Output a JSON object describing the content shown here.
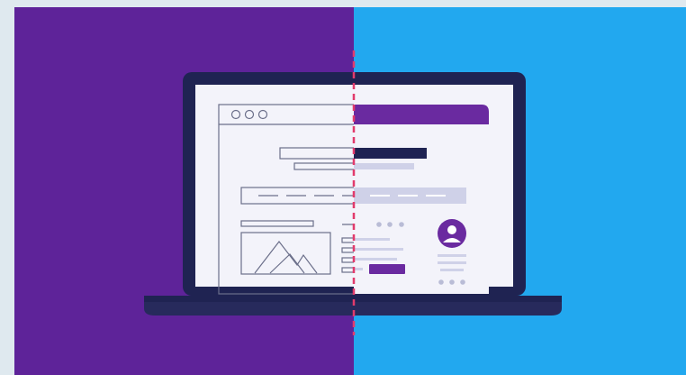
{
  "illustration": {
    "concept": "wireframe-to-design-split",
    "colors": {
      "outer_border": "#dfe9ef",
      "left_background": "#5e2399",
      "right_background": "#22a8ef",
      "laptop_frame": "#1f2352",
      "laptop_base": "#272a5c",
      "screen_background": "#f3f3fa",
      "wireframe_stroke": "#6b6f8a",
      "design_header": "#6a2aa0",
      "design_dark_bar": "#1f2352",
      "design_light_bar": "#cfd1e8",
      "design_dots": "#b9bcd6",
      "avatar_fill": "#6a2aa0",
      "design_button": "#6a2aa0",
      "divider_line": "#e23b6c"
    },
    "icons": {
      "window_controls": "three-circles",
      "image_placeholder": "mountains-icon",
      "avatar": "user-avatar-icon"
    }
  }
}
